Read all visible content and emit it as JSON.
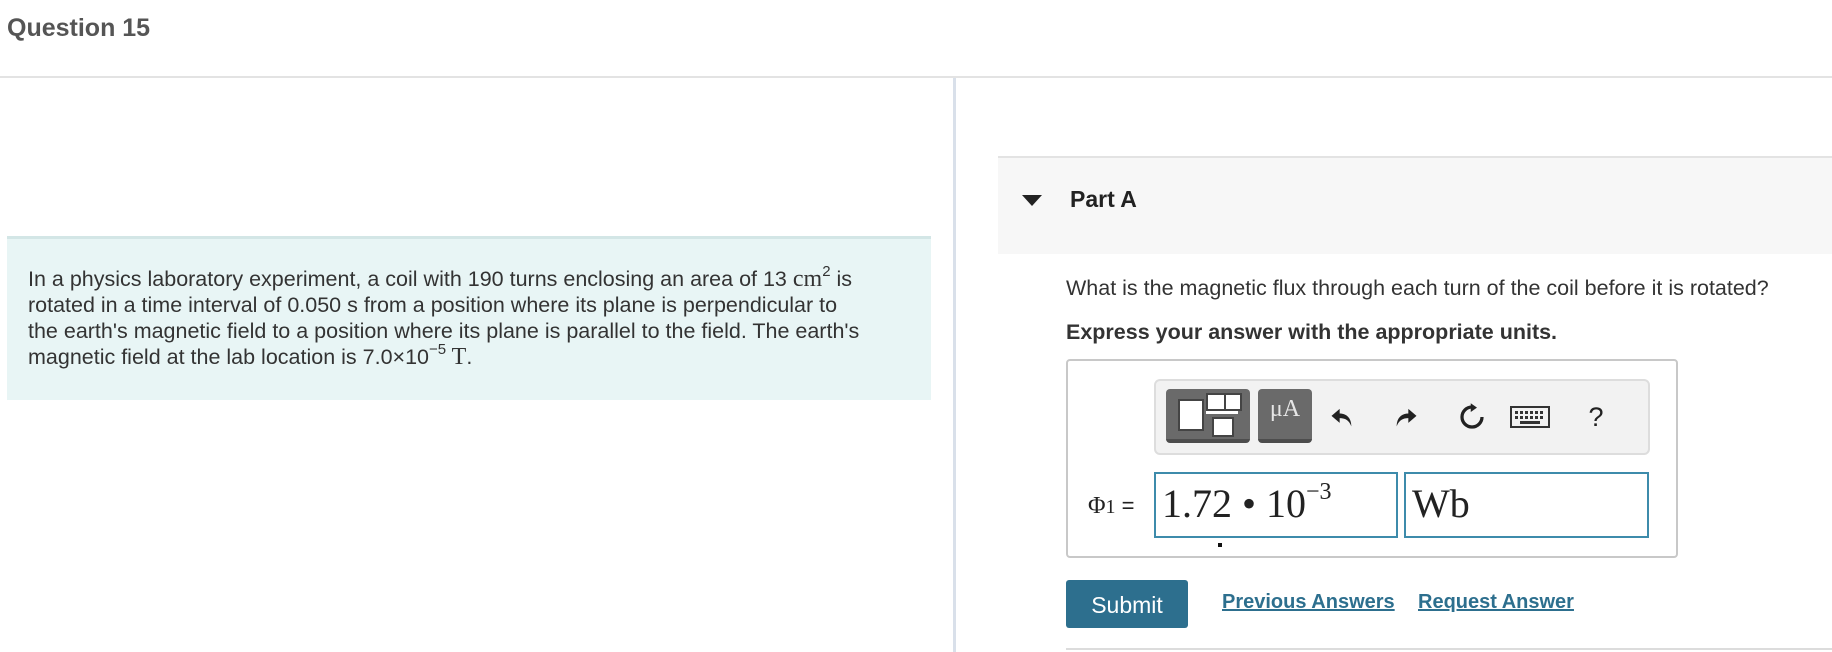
{
  "question_title": "Question 15",
  "problem": {
    "line1_pre": "In a physics laboratory experiment, a coil with 190 turns enclosing an area of 13 ",
    "line1_unit": "cm",
    "line1_exp": "2",
    "line1_post": " is",
    "line2": "rotated in a time interval of 0.050 s  from a position where its plane is perpendicular to",
    "line3": "the earth's magnetic field to a position where its plane is parallel to the field. The earth's",
    "line4_pre": "magnetic field at the lab location is 7.0×10",
    "line4_exp": "−5",
    "line4_unit": " T",
    "line4_post": "."
  },
  "part": {
    "title": "Part A",
    "question": "What is the magnetic flux through each turn of the coil before it is rotated?",
    "instruction": "Express your answer with the appropriate units."
  },
  "toolbar": {
    "units_label": "μA",
    "help_label": "?",
    "icons": [
      "templates-icon",
      "undo-icon",
      "redo-icon",
      "reset-icon",
      "keyboard-icon",
      "help-icon"
    ]
  },
  "answer": {
    "label_symbol": "Φ",
    "label_sub": "1",
    "label_eq": " =",
    "value_mantissa": "1.72 • 10",
    "value_exponent": "−3",
    "unit": "Wb"
  },
  "actions": {
    "submit": "Submit",
    "previous_answers": "Previous Answers",
    "request_answer": "Request Answer"
  },
  "colors": {
    "accent": "#2d6f8e",
    "problem_bg": "#e8f5f5",
    "field_border": "#3d8bab"
  }
}
